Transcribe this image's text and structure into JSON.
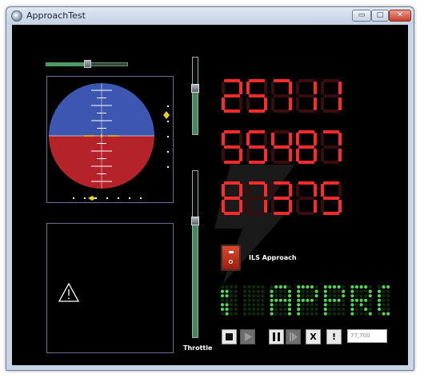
{
  "window": {
    "title": "ApproachTest",
    "min_glyph": "▭",
    "max_glyph": "□",
    "close_glyph": "✕"
  },
  "sliders": {
    "horizontal_level": 0.5,
    "vertical_top_level": 0.6,
    "throttle_level": 0.7,
    "throttle_label": "Throttle"
  },
  "attitude": {
    "sky_color": "#3d57b0",
    "ground_color": "#b5232a",
    "pitch_color": "#ffffff",
    "heading_marker_color": "#e8d020"
  },
  "readouts": {
    "active_color": "#ff2b2b",
    "inactive_color": "#3a0d0d",
    "values": [
      "25711",
      "55487",
      "87375"
    ]
  },
  "ils": {
    "label": "ILS Approach",
    "switch_color": "#c83520"
  },
  "marquee": {
    "text": "; APPROA",
    "dot_color": "#4fd84f",
    "dim_color": "#0f2a0f"
  },
  "controls": {
    "stop_icon": "stop-icon",
    "play_icon": "play-icon",
    "pause_icon": "pause-icon",
    "step_icon": "step-icon",
    "clear_icon": "x-icon",
    "alert_icon": "exclamation-icon",
    "x_label": "X",
    "alert_label": "!",
    "value": "77,700"
  }
}
